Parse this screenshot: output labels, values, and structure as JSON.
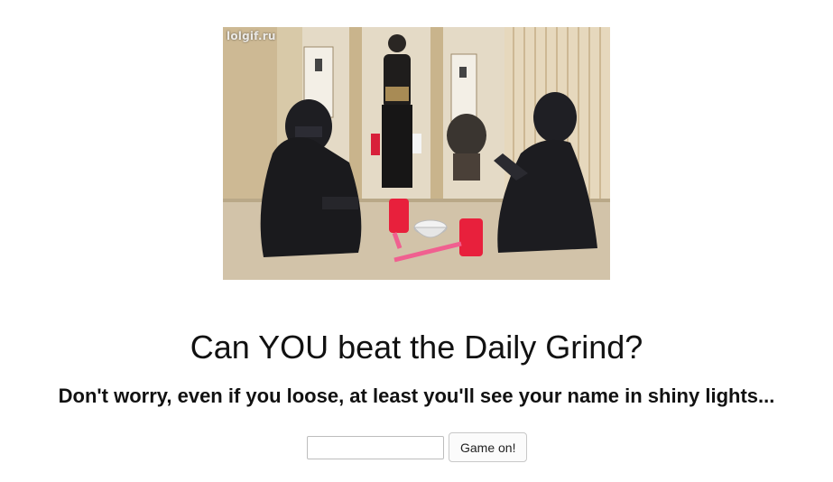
{
  "hero": {
    "watermark": "lolgif.ru"
  },
  "headline": "Can YOU beat the Daily Grind?",
  "subline": "Don't worry, even if you loose, at least you'll see your name in shiny lights...",
  "form": {
    "name_value": "",
    "name_placeholder": "",
    "submit_label": "Game on!"
  }
}
